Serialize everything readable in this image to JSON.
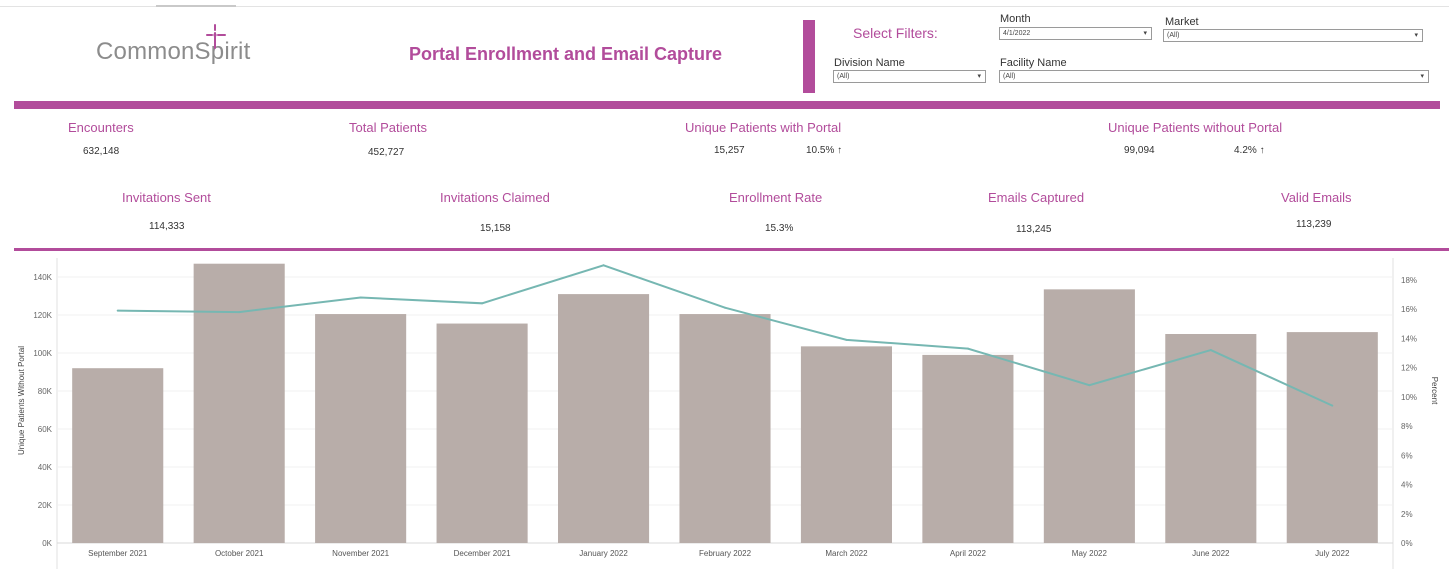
{
  "header": {
    "logo_text": "CommonSpirit",
    "title": "Portal Enrollment and Email Capture"
  },
  "colors": {
    "accent": "#b24c9b",
    "bar": "#b8ada9",
    "line": "#76b7b2"
  },
  "filters": {
    "heading": "Select Filters:",
    "month": {
      "label": "Month",
      "value": "4/1/2022"
    },
    "market": {
      "label": "Market",
      "value": "(All)"
    },
    "division": {
      "label": "Division Name",
      "value": "(All)"
    },
    "facility": {
      "label": "Facility Name",
      "value": "(All)"
    }
  },
  "kpis_row1": {
    "encounters": {
      "label": "Encounters",
      "value": "632,148"
    },
    "total_patients": {
      "label": "Total Patients",
      "value": "452,727"
    },
    "with_portal": {
      "label": "Unique Patients with Portal",
      "value": "15,257",
      "pct": "10.5% ↑"
    },
    "without_portal": {
      "label": "Unique Patients without Portal",
      "value": "99,094",
      "pct": "4.2% ↑"
    }
  },
  "kpis_row2": {
    "invitations_sent": {
      "label": "Invitations Sent",
      "value": "114,333"
    },
    "invitations_claimed": {
      "label": "Invitations Claimed",
      "value": "15,158"
    },
    "enrollment_rate": {
      "label": "Enrollment Rate",
      "value": "15.3%"
    },
    "emails_captured": {
      "label": "Emails Captured",
      "value": "113,245"
    },
    "valid_emails": {
      "label": "Valid Emails",
      "value": "113,239"
    }
  },
  "chart_data": {
    "type": "bar",
    "categories": [
      "September 2021",
      "October 2021",
      "November 2021",
      "December 2021",
      "January 2022",
      "February 2022",
      "March 2022",
      "April 2022",
      "May 2022",
      "June 2022",
      "July 2022"
    ],
    "series": [
      {
        "name": "Unique Patients Without Portal",
        "type": "bar",
        "axis": "left",
        "values": [
          92000,
          147000,
          120500,
          115500,
          131000,
          120500,
          103500,
          99000,
          133500,
          110000,
          111000
        ]
      },
      {
        "name": "Percent",
        "type": "line",
        "axis": "right",
        "values": [
          15.9,
          15.8,
          16.8,
          16.4,
          19.0,
          16.1,
          13.9,
          13.3,
          10.8,
          13.2,
          9.4
        ]
      }
    ],
    "ylabel": "Unique Patients Without Portal",
    "y2label": "Percent",
    "ylim": [
      0,
      150000
    ],
    "y2lim": [
      0,
      19.5
    ],
    "yticks": [
      "0K",
      "20K",
      "40K",
      "60K",
      "80K",
      "100K",
      "120K",
      "140K"
    ],
    "y2ticks": [
      "0%",
      "2%",
      "4%",
      "6%",
      "8%",
      "10%",
      "12%",
      "14%",
      "16%",
      "18%"
    ],
    "grid": true
  }
}
